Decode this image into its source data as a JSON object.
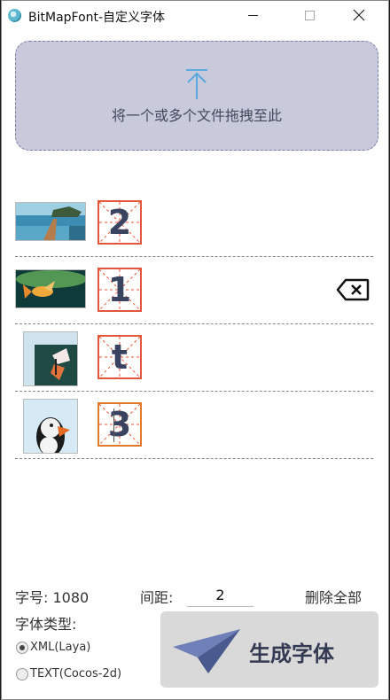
{
  "window": {
    "title": "BitMapFont-自定义字体",
    "minimize_label": "—",
    "close_label": "✕"
  },
  "dropzone": {
    "text": "将一个或多个文件拖拽至此",
    "icon": "upload-arrow-icon"
  },
  "list": {
    "items": [
      {
        "image": "pier-sea-image",
        "char": "2"
      },
      {
        "image": "fish-underwater-image",
        "char": "1"
      },
      {
        "image": "butterfly-image",
        "char": "t"
      },
      {
        "image": "puffin-image",
        "char": "3"
      }
    ],
    "delete_icon": "backspace-icon"
  },
  "settings": {
    "font_size_label": "字号:",
    "font_size_value": "1080",
    "spacing_label": "间距:",
    "spacing_value": "2",
    "delete_all_label": "删除全部",
    "font_type_label": "字体类型:",
    "options": [
      {
        "label": "XML(Laya)",
        "checked": true
      },
      {
        "label": "TEXT(Cocos-2d)",
        "checked": false
      }
    ]
  },
  "generate": {
    "label": "生成字体",
    "icon": "paper-plane-icon"
  },
  "colors": {
    "dropzone_bg": "#c8c9db",
    "glyph_border": "#e4563a",
    "glyph_text": "#3a4460",
    "button_bg": "#d9d9d9"
  }
}
